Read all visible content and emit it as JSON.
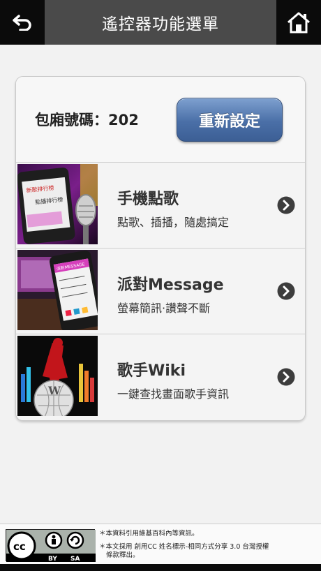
{
  "header": {
    "title": "遙控器功能選單",
    "back_icon": "back-arrow-icon",
    "home_icon": "home-icon"
  },
  "room": {
    "label": "包廂號碼：202",
    "reset_button": "重新設定"
  },
  "menu": [
    {
      "title": "手機點歌",
      "subtitle": "點歌、插播，隨處搞定",
      "thumb_lines": [
        "新歌排行榜",
        "點播排行榜"
      ]
    },
    {
      "title": "派對Message",
      "subtitle": "螢幕簡訊·讚聲不斷",
      "thumb_lines": [
        "派對MESSAGE"
      ]
    },
    {
      "title": "歌手Wiki",
      "subtitle": "一鍵查找畫面歌手資訊",
      "thumb_lines": [
        "W"
      ]
    }
  ],
  "footer": {
    "line1": "＊本資料引用維基百科內等資訊。",
    "line2": "＊本文採用 創用CC 姓名標示-相同方式分享 3.0 台灣授權",
    "line3": "條款釋出。",
    "badge": {
      "cc": "cc",
      "by": "BY",
      "sa": "SA"
    }
  },
  "colors": {
    "topbar": "#0b0b0b",
    "title_box": "#4a4a4a",
    "button_blue": "#4a6fa7"
  }
}
